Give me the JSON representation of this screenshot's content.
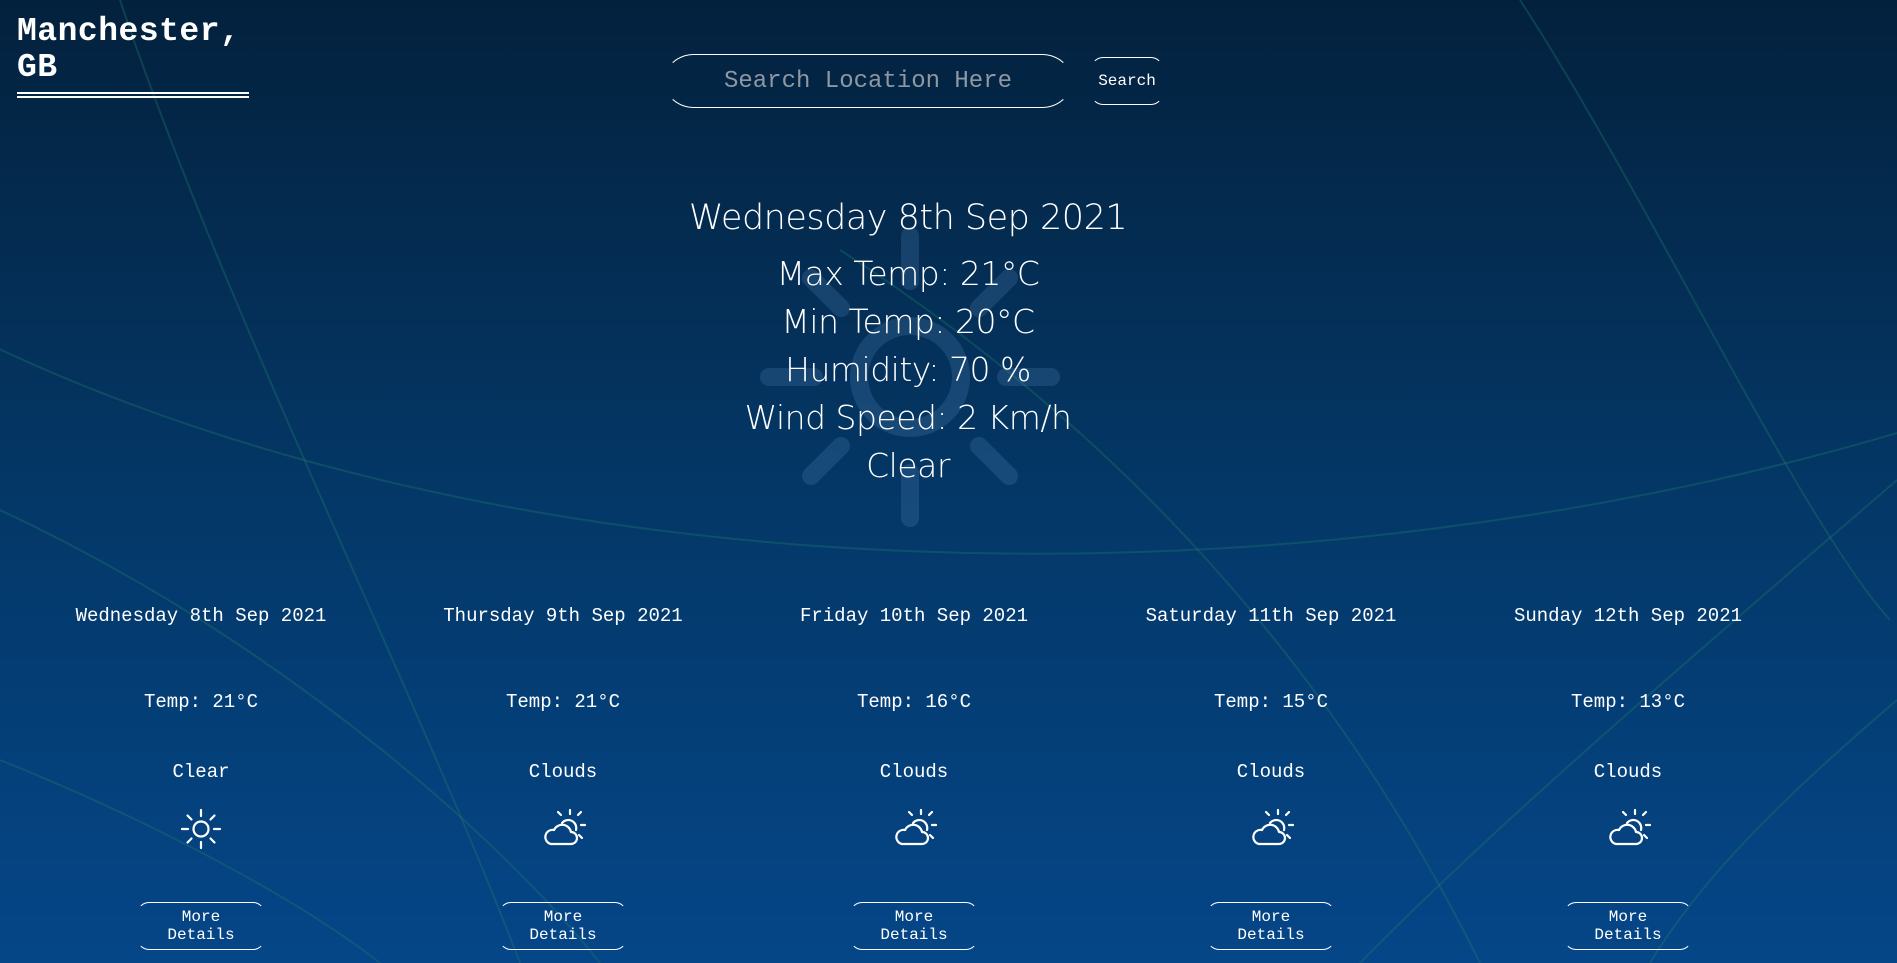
{
  "header": {
    "location": "Manchester,\nGB"
  },
  "search": {
    "placeholder": "Search Location Here",
    "value": "",
    "button_label": "Search"
  },
  "current": {
    "date": "Wednesday 8th Sep 2021",
    "max_temp": "Max Temp: 21°C",
    "min_temp": "Min Temp: 20°C",
    "humidity": "Humidity: 70 %",
    "wind_speed": "Wind Speed: 2 Km/h",
    "condition": "Clear",
    "background_icon": "sun-icon"
  },
  "forecast": [
    {
      "date": "Wednesday 8th Sep 2021",
      "temp": "Temp: 21°C",
      "condition": "Clear",
      "icon": "sun-icon",
      "button_label": "More Details"
    },
    {
      "date": "Thursday 9th Sep 2021",
      "temp": "Temp: 21°C",
      "condition": "Clouds",
      "icon": "partly-cloudy-icon",
      "button_label": "More Details"
    },
    {
      "date": "Friday 10th Sep 2021",
      "temp": "Temp: 16°C",
      "condition": "Clouds",
      "icon": "partly-cloudy-icon",
      "button_label": "More Details"
    },
    {
      "date": "Saturday 11th Sep 2021",
      "temp": "Temp: 15°C",
      "condition": "Clouds",
      "icon": "partly-cloudy-icon",
      "button_label": "More Details"
    },
    {
      "date": "Sunday 12th Sep 2021",
      "temp": "Temp: 13°C",
      "condition": "Clouds",
      "icon": "partly-cloudy-icon",
      "button_label": "More Details"
    }
  ],
  "colors": {
    "background_top": "#03213d",
    "background_bottom": "#054688",
    "text": "#ffffff",
    "placeholder": "#8e97a2",
    "accent_lines": "#1f7a6a"
  }
}
